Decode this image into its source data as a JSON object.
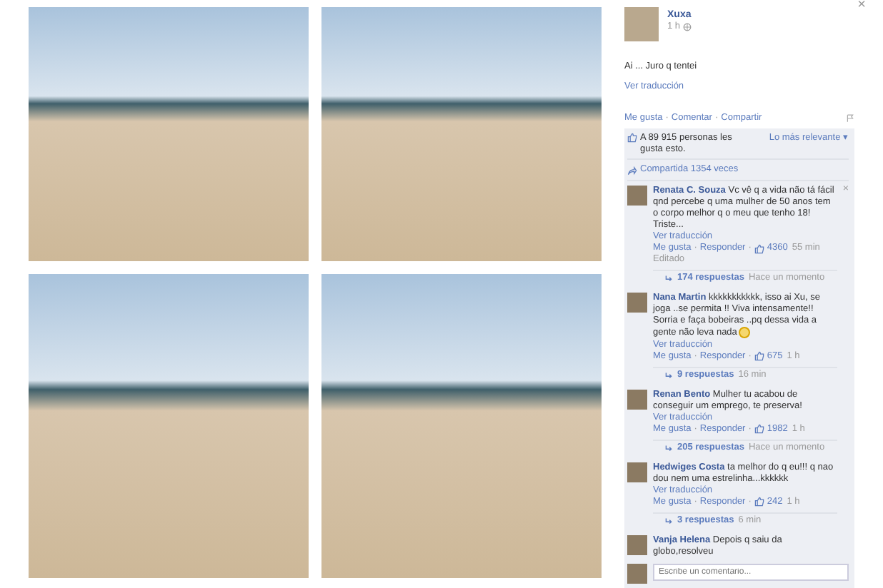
{
  "photos": [
    {
      "kind": "beach"
    },
    {
      "kind": "beach"
    },
    {
      "kind": "beach"
    },
    {
      "kind": "beach"
    }
  ],
  "close": "×",
  "post": {
    "author": "Xuxa",
    "time": "1 h",
    "text": "Ai ... Juro q tentei",
    "translate": "Ver traducción"
  },
  "separator": "·",
  "actions": [
    "Me gusta",
    "Comentar",
    "Compartir"
  ],
  "likes": {
    "text": "A 89 915 personas les gusta esto.",
    "sort": "Lo más relevante ▾"
  },
  "shares": "Compartida 1354 veces",
  "comments": [
    {
      "author": "Renata C. Souza",
      "text": "Vc vê q a vida não tá fácil qnd percebe q uma mulher de 50 anos tem o corpo melhor q o meu que tenho 18! Triste...",
      "emoji": false,
      "translate": "Ver traducción",
      "actions": [
        "Me gusta",
        "Responder"
      ],
      "likes": "4360",
      "time": "55 min",
      "edited": "Editado",
      "replies": "174 respuestas",
      "replies_time": "Hace un momento",
      "removable": true
    },
    {
      "author": "Nana Martin",
      "text": "kkkkkkkkkkk, isso ai Xu, se joga ..se permita !! Viva intensamente!! Sorria e faça bobeiras ..pq dessa vida a gente não leva nada",
      "emoji": true,
      "translate": "Ver traducción",
      "actions": [
        "Me gusta",
        "Responder"
      ],
      "likes": "675",
      "time": "1 h",
      "replies": "9 respuestas",
      "replies_time": "16 min",
      "removable": false
    },
    {
      "author": "Renan Bento",
      "text": "Mulher tu acabou de conseguir um emprego, te preserva!",
      "emoji": false,
      "translate": "Ver traducción",
      "actions": [
        "Me gusta",
        "Responder"
      ],
      "likes": "1982",
      "time": "1 h",
      "replies": "205 respuestas",
      "replies_time": "Hace un momento",
      "removable": false
    },
    {
      "author": "Hedwiges Costa",
      "text": "ta melhor do q eu!!! q nao dou nem uma estrelinha...kkkkkk",
      "emoji": false,
      "translate": "Ver traducción",
      "actions": [
        "Me gusta",
        "Responder"
      ],
      "likes": "242",
      "time": "1 h",
      "replies": "3 respuestas",
      "replies_time": "6 min",
      "removable": false
    },
    {
      "author": "Vanja Helena",
      "text": "Depois q saiu da globo,resolveu",
      "emoji": false,
      "removable": false
    }
  ],
  "comment_box": {
    "placeholder": "Escribe un comentario..."
  }
}
